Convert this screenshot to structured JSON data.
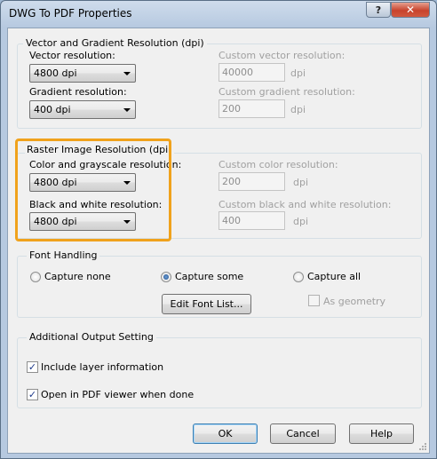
{
  "window": {
    "title": "DWG To PDF Properties",
    "help_glyph": "?",
    "close_glyph": "✕"
  },
  "vector_group": {
    "title": "Vector and Gradient Resolution (dpi)",
    "vector_label": "Vector resolution:",
    "vector_value": "4800 dpi",
    "gradient_label": "Gradient resolution:",
    "gradient_value": "400 dpi",
    "custom_vector_label": "Custom vector resolution:",
    "custom_vector_value": "40000",
    "custom_gradient_label": "Custom gradient resolution:",
    "custom_gradient_value": "200",
    "unit": "dpi"
  },
  "raster_group": {
    "title": "Raster Image Resolution (dpi)",
    "color_label": "Color and grayscale resolution:",
    "color_value": "4800 dpi",
    "bw_label": "Black and white resolution:",
    "bw_value": "4800 dpi",
    "custom_color_label": "Custom color resolution:",
    "custom_color_value": "200",
    "custom_bw_label": "Custom black and white resolution:",
    "custom_bw_value": "400",
    "unit": "dpi"
  },
  "font_group": {
    "title": "Font Handling",
    "capture_none": "Capture none",
    "capture_some": "Capture some",
    "capture_all": "Capture all",
    "edit_font_list": "Edit Font List...",
    "as_geometry": "As geometry"
  },
  "output_group": {
    "title": "Additional Output Setting",
    "include_layer": "Include layer information",
    "open_viewer": "Open in PDF viewer when done"
  },
  "buttons": {
    "ok": "OK",
    "cancel": "Cancel",
    "help": "Help"
  },
  "colors": {
    "highlight": "#f0a21c",
    "close_button": "#c8432c"
  }
}
